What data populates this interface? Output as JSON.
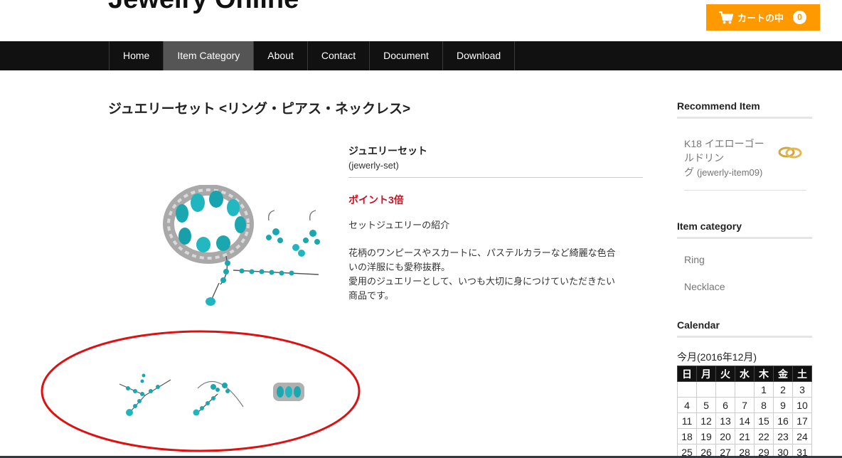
{
  "header": {
    "site_title": "Jewelry Online",
    "cart_label": "カートの中",
    "cart_count": "0"
  },
  "nav": {
    "items": [
      {
        "label": "Home"
      },
      {
        "label": "Item Category"
      },
      {
        "label": "About"
      },
      {
        "label": "Contact"
      },
      {
        "label": "Document"
      },
      {
        "label": "Download"
      }
    ],
    "active_index": 1
  },
  "product": {
    "page_title": "ジュエリーセット <リング・ピアス・ネックレス>",
    "name": "ジュエリーセット",
    "code": "(jewerly-set)",
    "point": "ポイント3倍",
    "intro_title": "セットジュエリーの紹介",
    "description_lines": [
      "花柄のワンピースやスカートに、パステルカラーなど綺麗な色合",
      "いの洋服にも愛称抜群。",
      "愛用のジュエリーとして、いつも大切に身につけていただきたい",
      "商品です。"
    ]
  },
  "thumbnails": [
    {
      "icon": "necklace-thumbnail"
    },
    {
      "icon": "necklace-earrings-thumbnail"
    },
    {
      "icon": "bracelet-thumbnail"
    }
  ],
  "sidebar": {
    "recommend_heading": "Recommend Item",
    "recommend_item_lines": [
      "K18 イエローゴー",
      "ルドリン",
      "グ"
    ],
    "recommend_item_code": "(jewerly-item09)",
    "category_heading": "Item category",
    "categories": [
      "Ring",
      "Necklace"
    ],
    "calendar_heading": "Calendar",
    "calendar_caption": "今月(2016年12月)",
    "weekdays": [
      "日",
      "月",
      "火",
      "水",
      "木",
      "金",
      "土"
    ],
    "weeks": [
      [
        "",
        "",
        "",
        "",
        "1",
        "2",
        "3"
      ],
      [
        "4",
        "5",
        "6",
        "7",
        "8",
        "9",
        "10"
      ],
      [
        "11",
        "12",
        "13",
        "14",
        "15",
        "16",
        "17"
      ],
      [
        "18",
        "19",
        "20",
        "21",
        "22",
        "23",
        "24"
      ],
      [
        "25",
        "26",
        "27",
        "28",
        "29",
        "30",
        "31"
      ]
    ]
  },
  "colors": {
    "accent": "#ff9900",
    "nav_bg": "#111111",
    "nav_active": "#555555",
    "point_red": "#cc1122",
    "annotation": "#dd1111"
  }
}
